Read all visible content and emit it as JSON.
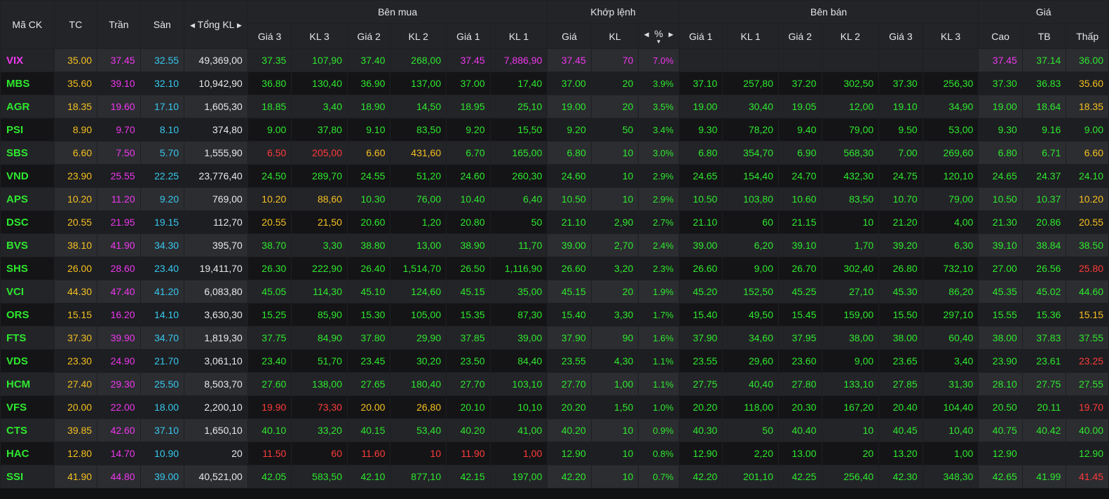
{
  "colors": {
    "up": "#2ee82e",
    "reference": "#f5c020",
    "ceiling": "#ee37ee",
    "floor": "#36c8ee",
    "down": "#ff3b3b"
  },
  "header": {
    "symbol": "Mã CK",
    "ref": "TC",
    "ceiling": "Trần",
    "floor": "Sàn",
    "total_volume": "Tổng KL",
    "bid_group": "Bên mua",
    "match_group": "Khớp lệnh",
    "ask_group": "Bên bán",
    "price_group": "Giá",
    "bid_cols": [
      "Giá 3",
      "KL 3",
      "Giá 2",
      "KL 2",
      "Giá 1",
      "KL 1"
    ],
    "match_cols": [
      "Giá",
      "KL",
      "%"
    ],
    "ask_cols": [
      "Giá 1",
      "KL 1",
      "Giá 2",
      "KL 2",
      "Giá 3",
      "KL 3"
    ],
    "price_cols": [
      "Cao",
      "TB",
      "Thấp"
    ]
  },
  "icons": {
    "left": "arrow-left-icon",
    "right": "arrow-right-icon",
    "sort": "sort-down-icon"
  },
  "rows": [
    {
      "sym": "VIX",
      "tc": "35.00",
      "tran": "37.45",
      "san": "32.55",
      "tkl": "49,369,00",
      "b3p": "37.35",
      "b3v": "107,90",
      "b2p": "37.40",
      "b2v": "268,00",
      "b1p": "37.45",
      "b1v": "7,886,90",
      "mp": "37.45",
      "mv": "70",
      "pct": "7.0%",
      "a1p": "",
      "a1v": "",
      "a2p": "",
      "a2v": "",
      "a3p": "",
      "a3v": "",
      "high": "37.45",
      "avg": "37.14",
      "low": "36.00"
    },
    {
      "sym": "MBS",
      "tc": "35.60",
      "tran": "39.10",
      "san": "32.10",
      "tkl": "10,942,90",
      "b3p": "36.80",
      "b3v": "130,40",
      "b2p": "36.90",
      "b2v": "137,00",
      "b1p": "37.00",
      "b1v": "17,40",
      "mp": "37.00",
      "mv": "20",
      "pct": "3.9%",
      "a1p": "37.10",
      "a1v": "257,80",
      "a2p": "37.20",
      "a2v": "302,50",
      "a3p": "37.30",
      "a3v": "256,30",
      "high": "37.30",
      "avg": "36.83",
      "low": "35.60"
    },
    {
      "sym": "AGR",
      "tc": "18.35",
      "tran": "19.60",
      "san": "17.10",
      "tkl": "1,605,30",
      "b3p": "18.85",
      "b3v": "3,40",
      "b2p": "18.90",
      "b2v": "14,50",
      "b1p": "18.95",
      "b1v": "25,10",
      "mp": "19.00",
      "mv": "20",
      "pct": "3.5%",
      "a1p": "19.00",
      "a1v": "30,40",
      "a2p": "19.05",
      "a2v": "12,00",
      "a3p": "19.10",
      "a3v": "34,90",
      "high": "19.00",
      "avg": "18.64",
      "low": "18.35"
    },
    {
      "sym": "PSI",
      "tc": "8.90",
      "tran": "9.70",
      "san": "8.10",
      "tkl": "374,80",
      "b3p": "9.00",
      "b3v": "37,80",
      "b2p": "9.10",
      "b2v": "83,50",
      "b1p": "9.20",
      "b1v": "15,50",
      "mp": "9.20",
      "mv": "50",
      "pct": "3.4%",
      "a1p": "9.30",
      "a1v": "78,20",
      "a2p": "9.40",
      "a2v": "79,00",
      "a3p": "9.50",
      "a3v": "53,00",
      "high": "9.30",
      "avg": "9.16",
      "low": "9.00"
    },
    {
      "sym": "SBS",
      "tc": "6.60",
      "tran": "7.50",
      "san": "5.70",
      "tkl": "1,555,90",
      "b3p": "6.50",
      "b3v": "205,00",
      "b2p": "6.60",
      "b2v": "431,60",
      "b1p": "6.70",
      "b1v": "165,00",
      "mp": "6.80",
      "mv": "10",
      "pct": "3.0%",
      "a1p": "6.80",
      "a1v": "354,70",
      "a2p": "6.90",
      "a2v": "568,30",
      "a3p": "7.00",
      "a3v": "269,60",
      "high": "6.80",
      "avg": "6.71",
      "low": "6.60"
    },
    {
      "sym": "VND",
      "tc": "23.90",
      "tran": "25.55",
      "san": "22.25",
      "tkl": "23,776,40",
      "b3p": "24.50",
      "b3v": "289,70",
      "b2p": "24.55",
      "b2v": "51,20",
      "b1p": "24.60",
      "b1v": "260,30",
      "mp": "24.60",
      "mv": "10",
      "pct": "2.9%",
      "a1p": "24.65",
      "a1v": "154,40",
      "a2p": "24.70",
      "a2v": "432,30",
      "a3p": "24.75",
      "a3v": "120,10",
      "high": "24.65",
      "avg": "24.37",
      "low": "24.10"
    },
    {
      "sym": "APS",
      "tc": "10.20",
      "tran": "11.20",
      "san": "9.20",
      "tkl": "769,00",
      "b3p": "10.20",
      "b3v": "88,60",
      "b2p": "10.30",
      "b2v": "76,00",
      "b1p": "10.40",
      "b1v": "6,40",
      "mp": "10.50",
      "mv": "10",
      "pct": "2.9%",
      "a1p": "10.50",
      "a1v": "103,80",
      "a2p": "10.60",
      "a2v": "83,50",
      "a3p": "10.70",
      "a3v": "79,00",
      "high": "10.50",
      "avg": "10.37",
      "low": "10.20"
    },
    {
      "sym": "DSC",
      "tc": "20.55",
      "tran": "21.95",
      "san": "19.15",
      "tkl": "112,70",
      "b3p": "20.55",
      "b3v": "21,50",
      "b2p": "20.60",
      "b2v": "1,20",
      "b1p": "20.80",
      "b1v": "50",
      "mp": "21.10",
      "mv": "2,90",
      "pct": "2.7%",
      "a1p": "21.10",
      "a1v": "60",
      "a2p": "21.15",
      "a2v": "10",
      "a3p": "21.20",
      "a3v": "4,00",
      "high": "21.30",
      "avg": "20.86",
      "low": "20.55"
    },
    {
      "sym": "BVS",
      "tc": "38.10",
      "tran": "41.90",
      "san": "34.30",
      "tkl": "395,70",
      "b3p": "38.70",
      "b3v": "3,30",
      "b2p": "38.80",
      "b2v": "13,00",
      "b1p": "38.90",
      "b1v": "11,70",
      "mp": "39.00",
      "mv": "2,70",
      "pct": "2.4%",
      "a1p": "39.00",
      "a1v": "6,20",
      "a2p": "39.10",
      "a2v": "1,70",
      "a3p": "39.20",
      "a3v": "6,30",
      "high": "39.10",
      "avg": "38.84",
      "low": "38.50"
    },
    {
      "sym": "SHS",
      "tc": "26.00",
      "tran": "28.60",
      "san": "23.40",
      "tkl": "19,411,70",
      "b3p": "26.30",
      "b3v": "222,90",
      "b2p": "26.40",
      "b2v": "1,514,70",
      "b1p": "26.50",
      "b1v": "1,116,90",
      "mp": "26.60",
      "mv": "3,20",
      "pct": "2.3%",
      "a1p": "26.60",
      "a1v": "9,00",
      "a2p": "26.70",
      "a2v": "302,40",
      "a3p": "26.80",
      "a3v": "732,10",
      "high": "27.00",
      "avg": "26.56",
      "low": "25.80"
    },
    {
      "sym": "VCI",
      "tc": "44.30",
      "tran": "47.40",
      "san": "41.20",
      "tkl": "6,083,80",
      "b3p": "45.05",
      "b3v": "114,30",
      "b2p": "45.10",
      "b2v": "124,60",
      "b1p": "45.15",
      "b1v": "35,00",
      "mp": "45.15",
      "mv": "20",
      "pct": "1.9%",
      "a1p": "45.20",
      "a1v": "152,50",
      "a2p": "45.25",
      "a2v": "27,10",
      "a3p": "45.30",
      "a3v": "86,20",
      "high": "45.35",
      "avg": "45.02",
      "low": "44.60"
    },
    {
      "sym": "ORS",
      "tc": "15.15",
      "tran": "16.20",
      "san": "14.10",
      "tkl": "3,630,30",
      "b3p": "15.25",
      "b3v": "85,90",
      "b2p": "15.30",
      "b2v": "105,00",
      "b1p": "15.35",
      "b1v": "87,30",
      "mp": "15.40",
      "mv": "3,30",
      "pct": "1.7%",
      "a1p": "15.40",
      "a1v": "49,50",
      "a2p": "15.45",
      "a2v": "159,00",
      "a3p": "15.50",
      "a3v": "297,10",
      "high": "15.55",
      "avg": "15.36",
      "low": "15.15"
    },
    {
      "sym": "FTS",
      "tc": "37.30",
      "tran": "39.90",
      "san": "34.70",
      "tkl": "1,819,30",
      "b3p": "37.75",
      "b3v": "84,90",
      "b2p": "37.80",
      "b2v": "29,90",
      "b1p": "37.85",
      "b1v": "39,00",
      "mp": "37.90",
      "mv": "90",
      "pct": "1.6%",
      "a1p": "37.90",
      "a1v": "34,60",
      "a2p": "37.95",
      "a2v": "38,00",
      "a3p": "38.00",
      "a3v": "60,40",
      "high": "38.00",
      "avg": "37.83",
      "low": "37.55"
    },
    {
      "sym": "VDS",
      "tc": "23.30",
      "tran": "24.90",
      "san": "21.70",
      "tkl": "3,061,10",
      "b3p": "23.40",
      "b3v": "51,70",
      "b2p": "23.45",
      "b2v": "30,20",
      "b1p": "23.50",
      "b1v": "84,40",
      "mp": "23.55",
      "mv": "4,30",
      "pct": "1.1%",
      "a1p": "23.55",
      "a1v": "29,60",
      "a2p": "23.60",
      "a2v": "9,00",
      "a3p": "23.65",
      "a3v": "3,40",
      "high": "23.90",
      "avg": "23.61",
      "low": "23.25"
    },
    {
      "sym": "HCM",
      "tc": "27.40",
      "tran": "29.30",
      "san": "25.50",
      "tkl": "8,503,70",
      "b3p": "27.60",
      "b3v": "138,00",
      "b2p": "27.65",
      "b2v": "180,40",
      "b1p": "27.70",
      "b1v": "103,10",
      "mp": "27.70",
      "mv": "1,00",
      "pct": "1.1%",
      "a1p": "27.75",
      "a1v": "40,40",
      "a2p": "27.80",
      "a2v": "133,10",
      "a3p": "27.85",
      "a3v": "31,30",
      "high": "28.10",
      "avg": "27.75",
      "low": "27.55"
    },
    {
      "sym": "VFS",
      "tc": "20.00",
      "tran": "22.00",
      "san": "18.00",
      "tkl": "2,200,10",
      "b3p": "19.90",
      "b3v": "73,30",
      "b2p": "20.00",
      "b2v": "26,80",
      "b1p": "20.10",
      "b1v": "10,10",
      "mp": "20.20",
      "mv": "1,50",
      "pct": "1.0%",
      "a1p": "20.20",
      "a1v": "118,00",
      "a2p": "20.30",
      "a2v": "167,20",
      "a3p": "20.40",
      "a3v": "104,40",
      "high": "20.50",
      "avg": "20.11",
      "low": "19.70"
    },
    {
      "sym": "CTS",
      "tc": "39.85",
      "tran": "42.60",
      "san": "37.10",
      "tkl": "1,650,10",
      "b3p": "40.10",
      "b3v": "33,20",
      "b2p": "40.15",
      "b2v": "53,40",
      "b1p": "40.20",
      "b1v": "41,00",
      "mp": "40.20",
      "mv": "10",
      "pct": "0.9%",
      "a1p": "40.30",
      "a1v": "50",
      "a2p": "40.40",
      "a2v": "10",
      "a3p": "40.45",
      "a3v": "10,40",
      "high": "40.75",
      "avg": "40.42",
      "low": "40.00"
    },
    {
      "sym": "HAC",
      "tc": "12.80",
      "tran": "14.70",
      "san": "10.90",
      "tkl": "20",
      "b3p": "11.50",
      "b3v": "60",
      "b2p": "11.60",
      "b2v": "10",
      "b1p": "11.90",
      "b1v": "1,00",
      "mp": "12.90",
      "mv": "10",
      "pct": "0.8%",
      "a1p": "12.90",
      "a1v": "2,20",
      "a2p": "13.00",
      "a2v": "20",
      "a3p": "13.20",
      "a3v": "1,00",
      "high": "12.90",
      "avg": "",
      "low": "12.90"
    },
    {
      "sym": "SSI",
      "tc": "41.90",
      "tran": "44.80",
      "san": "39.00",
      "tkl": "40,521,00",
      "b3p": "42.05",
      "b3v": "583,50",
      "b2p": "42.10",
      "b2v": "877,10",
      "b1p": "42.15",
      "b1v": "197,00",
      "mp": "42.20",
      "mv": "10",
      "pct": "0.7%",
      "a1p": "42.20",
      "a1v": "201,10",
      "a2p": "42.25",
      "a2v": "256,40",
      "a3p": "42.30",
      "a3v": "348,30",
      "high": "42.65",
      "avg": "41.99",
      "low": "41.45"
    }
  ]
}
